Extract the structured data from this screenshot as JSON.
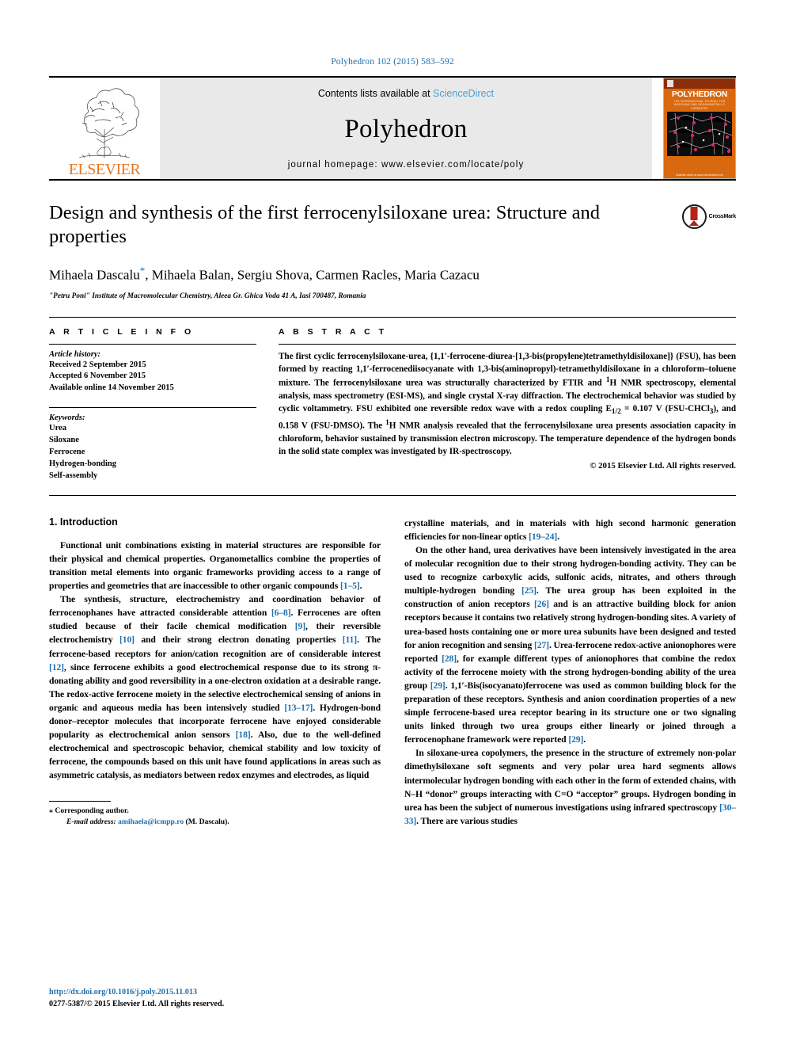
{
  "running_head": "Polyhedron 102 (2015) 583–592",
  "masthead": {
    "publisher": "ELSEVIER",
    "contents_prefix": "Contents lists available at ",
    "contents_link": "ScienceDirect",
    "journal_title": "Polyhedron",
    "homepage": "journal homepage: www.elsevier.com/locate/poly",
    "cover_name": "POLYHEDRON",
    "cover_sub": "THE INTERNATIONAL JOURNAL FOR INORGANIC AND ORGANOMETALLIC CHEMISTRY",
    "cover_foot": "Available online at\nwww.sciencedirect.com"
  },
  "article": {
    "title": "Design and synthesis of the first ferrocenylsiloxane urea: Structure and properties",
    "authors": "Mihaela Dascalu",
    "authors_rest": ", Mihaela Balan, Sergiu Shova, Carmen Racles, Maria Cazacu",
    "corresponding_mark": "*",
    "affiliation": "\"Petru Poni\" Institute of Macromolecular Chemistry, Aleea Gr. Ghica Voda 41 A, Iasi 700487, Romania",
    "crossmark_label": "CrossMark"
  },
  "info": {
    "heading": "A R T I C L E   I N F O",
    "history_label": "Article history:",
    "history": [
      "Received 2 September 2015",
      "Accepted 6 November 2015",
      "Available online 14 November 2015"
    ],
    "keywords_label": "Keywords:",
    "keywords": [
      "Urea",
      "Siloxane",
      "Ferrocene",
      "Hydrogen-bonding",
      "Self-assembly"
    ]
  },
  "abstract": {
    "heading": "A B S T R A C T",
    "text_1": "The first cyclic ferrocenylsiloxane-urea, {1,1′-ferrocene-diurea-[1,3-bis(propylene)tetramethyldisiloxane]} (FSU), has been formed by reacting 1,1′-ferrocenediisocyanate with 1,3-bis(aminopropyl)-tetramethyldisiloxane in a chloroform–toluene mixture. The ferrocenylsiloxane urea was structurally characterized by FTIR and ",
    "nmr_sup": "1",
    "text_2": "H NMR spectroscopy, elemental analysis, mass spectrometry (ESI-MS), and single crystal X-ray diffraction. The electrochemical behavior was studied by cyclic voltammetry. FSU exhibited one reversible redox wave with a redox coupling E",
    "e_sub": "1/2",
    "text_3": " = 0.107 V (FSU-CHCl",
    "chcl_sub": "3",
    "text_4": "), and 0.158 V (FSU-DMSO). The ",
    "nmr_sup2": "1",
    "text_5": "H NMR analysis revealed that the ferrocenylsiloxane urea presents association capacity in chloroform, behavior sustained by transmission electron microscopy. The temperature dependence of the hydrogen bonds in the solid state complex was investigated by IR-spectroscopy.",
    "copyright": "© 2015 Elsevier Ltd. All rights reserved."
  },
  "intro": {
    "heading": "1. Introduction",
    "left_paragraphs": [
      {
        "parts": [
          {
            "t": "Functional unit combinations existing in material structures are responsible for their physical and chemical properties. Organometallics combine the properties of transition metal elements into organic frameworks providing access to a range of properties and geometries that are inaccessible to other organic compounds "
          },
          {
            "t": "[1–5]",
            "cite": true
          },
          {
            "t": "."
          }
        ]
      },
      {
        "parts": [
          {
            "t": "The synthesis, structure, electrochemistry and coordination behavior of ferrocenophanes have attracted considerable attention "
          },
          {
            "t": "[6–8]",
            "cite": true
          },
          {
            "t": ". Ferrocenes are often studied because of their facile chemical modification "
          },
          {
            "t": "[9]",
            "cite": true
          },
          {
            "t": ", their reversible electrochemistry "
          },
          {
            "t": "[10]",
            "cite": true
          },
          {
            "t": " and their strong electron donating properties "
          },
          {
            "t": "[11]",
            "cite": true
          },
          {
            "t": ". The ferrocene-based receptors for anion/cation recognition are of considerable interest "
          },
          {
            "t": "[12]",
            "cite": true
          },
          {
            "t": ", since ferrocene exhibits a good electrochemical response due to its strong π-donating ability and good reversibility in a one-electron oxidation at a desirable range. The redox-active ferrocene moiety in the selective electrochemical sensing of anions in organic and aqueous media has been intensively studied "
          },
          {
            "t": "[13–17]",
            "cite": true
          },
          {
            "t": ". Hydrogen-bond donor–receptor molecules that incorporate ferrocene have enjoyed considerable popularity as electrochemical anion sensors "
          },
          {
            "t": "[18]",
            "cite": true
          },
          {
            "t": ". Also, due to the well-defined electrochemical and spectroscopic behavior, chemical stability and low toxicity of ferrocene, the compounds based on this unit have found applications in areas such as asymmetric catalysis, as mediators between redox enzymes and electrodes, as liquid"
          }
        ]
      }
    ],
    "right_paragraphs": [
      {
        "parts": [
          {
            "t": "crystalline materials, and in materials with high second harmonic generation efficiencies for non-linear optics "
          },
          {
            "t": "[19–24]",
            "cite": true
          },
          {
            "t": "."
          }
        ],
        "no_indent": true
      },
      {
        "parts": [
          {
            "t": "On the other hand, urea derivatives have been intensively investigated in the area of molecular recognition due to their strong hydrogen-bonding activity. They can be used to recognize carboxylic acids, sulfonic acids, nitrates, and others through multiple-hydrogen bonding "
          },
          {
            "t": "[25]",
            "cite": true
          },
          {
            "t": ". The urea group has been exploited in the construction of anion receptors "
          },
          {
            "t": "[26]",
            "cite": true
          },
          {
            "t": " and is an attractive building block for anion receptors because it contains two relatively strong hydrogen-bonding sites. A variety of urea-based hosts containing one or more urea subunits have been designed and tested for anion recognition and sensing "
          },
          {
            "t": "[27]",
            "cite": true
          },
          {
            "t": ". Urea-ferrocene redox-active anionophores were reported "
          },
          {
            "t": "[28]",
            "cite": true
          },
          {
            "t": ", for example different types of anionophores that combine the redox activity of the ferrocene moiety with the strong hydrogen-bonding ability of the urea group "
          },
          {
            "t": "[29]",
            "cite": true
          },
          {
            "t": ". 1,1′-Bis(isocyanato)ferrocene was used as common building block for the preparation of these receptors. Synthesis and anion coordination properties of a new simple ferrocene-based urea receptor bearing in its structure one or two signaling units linked through two urea groups either linearly or joined through a ferrocenophane framework were reported "
          },
          {
            "t": "[29]",
            "cite": true
          },
          {
            "t": "."
          }
        ]
      },
      {
        "parts": [
          {
            "t": "In siloxane-urea copolymers, the presence in the structure of extremely non-polar dimethylsiloxane soft segments and very polar urea hard segments allows intermolecular hydrogen bonding with each other in the form of extended chains, with N–H “donor” groups interacting with C=O “acceptor” groups. Hydrogen bonding in urea has been the subject of numerous investigations using infrared spectroscopy "
          },
          {
            "t": "[30–33]",
            "cite": true
          },
          {
            "t": ". There are various studies"
          }
        ]
      }
    ]
  },
  "footnote": {
    "corresponding": "Corresponding author.",
    "email_label": "E-mail address:",
    "email": "amihaela@icmpp.ro",
    "email_suffix": " (M. Dascalu)."
  },
  "footer": {
    "doi": "http://dx.doi.org/10.1016/j.poly.2015.11.013",
    "issn_line": "0277-5387/© 2015 Elsevier Ltd. All rights reserved."
  },
  "colors": {
    "link": "#1f6fae",
    "elsevier_orange": "#e87722",
    "sciencedirect": "#4a9fd4",
    "banner_bg": "#e9e9e9"
  }
}
